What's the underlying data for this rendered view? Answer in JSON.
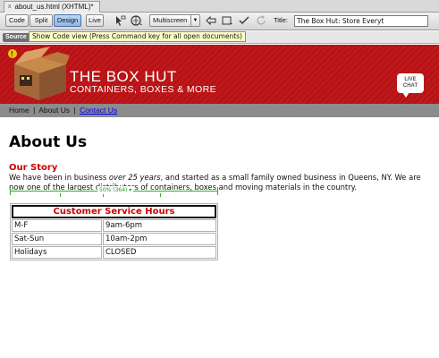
{
  "document_tab": {
    "filename": "about_us.html (XHTML)*",
    "close": "x"
  },
  "toolbar": {
    "code_label": "Code",
    "split_label": "Split",
    "design_label": "Design",
    "live_label": "Live",
    "multiscreen_label": "Multiscreen",
    "title_label": "Title:",
    "title_value": "The Box Hut: Store Everyt"
  },
  "subbar": {
    "source_label": "Source"
  },
  "tooltip": {
    "text": "Show Code view (Press Command key for all open documents)"
  },
  "banner": {
    "title": "THE BOX HUT",
    "subtitle": "CONTAINERS, BOXES & MORE",
    "live_chat_line1": "LIVE",
    "live_chat_line2": "CHAT"
  },
  "nav": {
    "home": "Home",
    "about": "About Us",
    "contact": "Contact Us",
    "separator": "|"
  },
  "content": {
    "page_title": "About Us",
    "story_heading": "Our Story",
    "story_part1": "We have been in business ",
    "story_emphasis": "over 25 years",
    "story_part2": ", and started as a small family owned business in Queens, NY. We are now one of the largest distributors of containers, boxes and moving materials in the country."
  },
  "width_indicator": {
    "label": "50% (364) ▾"
  },
  "hours_table": {
    "caption": "Customer Service Hours",
    "rows": [
      {
        "day": "M-F",
        "hours": "9am-6pm"
      },
      {
        "day": "Sat-Sun",
        "hours": "10am-2pm"
      },
      {
        "day": "Holidays",
        "hours": "CLOSED"
      }
    ]
  },
  "colors": {
    "banner_red": "#c0171a",
    "heading_red": "#cc0000",
    "nav_gray": "#8c8c8c",
    "link_blue": "#0000ee",
    "ruler_green": "#2bb12b"
  }
}
